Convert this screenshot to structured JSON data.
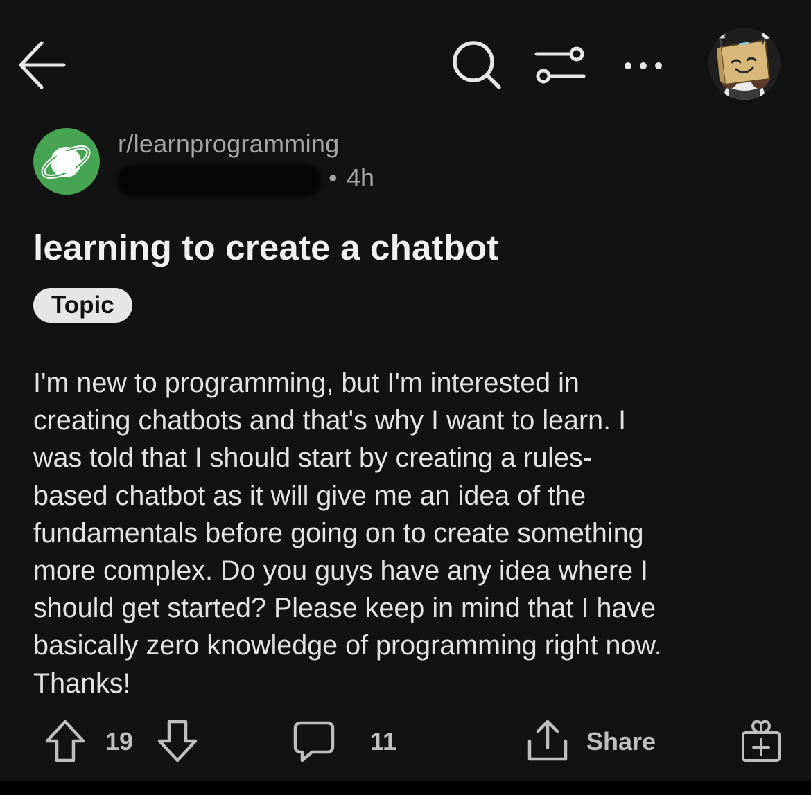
{
  "topbar": {
    "back_icon": "arrow-left-icon",
    "search_icon": "search-icon",
    "filter_icon": "sliders-icon",
    "more_icon": "more-horizontal-icon",
    "avatar_icon": "user-avatar"
  },
  "post": {
    "subreddit": "r/learnprogramming",
    "separator": "•",
    "time": "4h",
    "title": "learning to create a chatbot",
    "flair": "Topic",
    "body": "I'm new to programming, but I'm interested in\ncreating chatbots and that's why I want to learn.  I\nwas told that I should start by creating a rules-\nbased chatbot as it will give me an idea of the\nfundamentals before going on to create something\nmore complex.  Do you guys have any idea where I\nshould get started?  Please keep in mind that I have\nbasically zero knowledge of programming right now.\nThanks!"
  },
  "actions": {
    "score": "19",
    "comments": "11",
    "share_label": "Share"
  },
  "colors": {
    "background": "#121212",
    "subreddit_icon": "#46a552",
    "flair_bg": "#e6e6e6"
  }
}
